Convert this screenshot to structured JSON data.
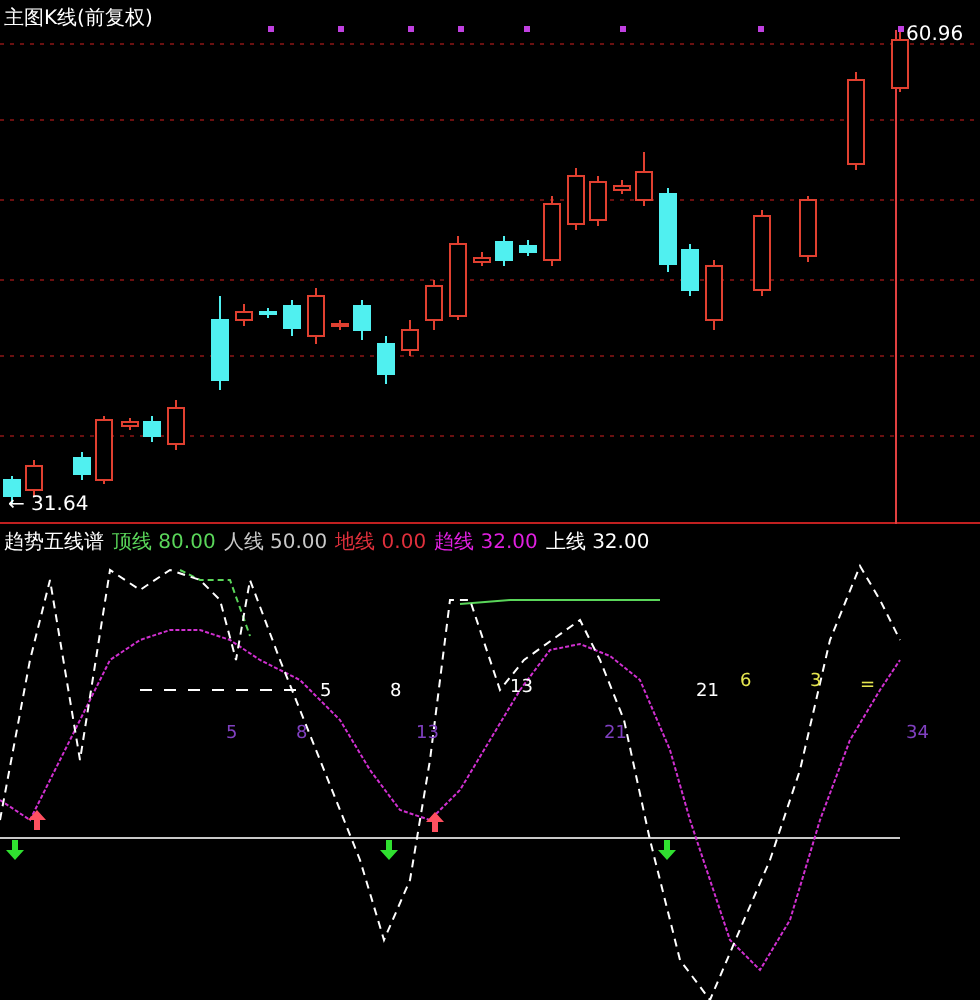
{
  "price_panel": {
    "title": "主图K线(前复权)",
    "high_label": "60.96",
    "low_label": "← 31.64"
  },
  "indicator_panel": {
    "name": "趋势五线谱",
    "legend": [
      {
        "label": "顶线",
        "value": "80.00",
        "color": "#5ad65a"
      },
      {
        "label": "人线",
        "value": "50.00",
        "color": "#c8c8c8"
      },
      {
        "label": "地线",
        "value": "0.00",
        "color": "#e0303c"
      },
      {
        "label": "趋线",
        "value": "32.00",
        "color": "#e020e0"
      },
      {
        "label": "上线",
        "value": "32.00",
        "color": "#ffffff"
      }
    ],
    "marks": [
      {
        "text": "5",
        "color": "#ffffff"
      },
      {
        "text": "8",
        "color": "#ffffff"
      },
      {
        "text": "13",
        "color": "#ffffff"
      },
      {
        "text": "21",
        "color": "#ffffff"
      },
      {
        "text": "6",
        "color": "#e6e650"
      },
      {
        "text": "3",
        "color": "#e6e650"
      },
      {
        "text": "=",
        "color": "#e6e650"
      },
      {
        "text": "5",
        "color": "#8040c0"
      },
      {
        "text": "8",
        "color": "#8040c0"
      },
      {
        "text": "13",
        "color": "#8040c0"
      },
      {
        "text": "21",
        "color": "#8040c0"
      },
      {
        "text": "34",
        "color": "#8040c0"
      }
    ]
  }
}
